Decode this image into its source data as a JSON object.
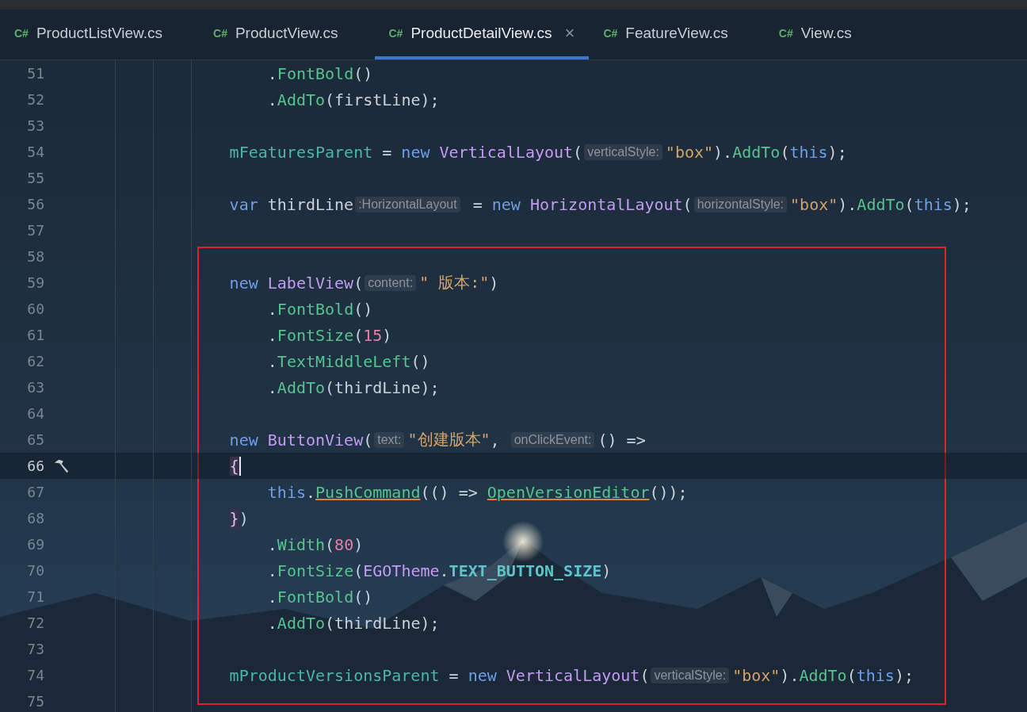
{
  "tabs": [
    {
      "icon": "C#",
      "label": "ProductListView.cs",
      "selected": false
    },
    {
      "icon": "C#",
      "label": "ProductView.cs",
      "selected": false
    },
    {
      "icon": "C#",
      "label": "ProductDetailView.cs",
      "selected": true,
      "close": "×"
    },
    {
      "icon": "C#",
      "label": "FeatureView.cs",
      "selected": false
    },
    {
      "icon": "C#",
      "label": "View.cs",
      "selected": false
    }
  ],
  "annotation": {
    "kind": "rectangle",
    "color": "#e0222c"
  },
  "lines": [
    {
      "number": "51",
      "current": false,
      "boxed": false,
      "kind": "continuation",
      "tokens": [
        {
          "kind": "plain",
          "text": "."
        },
        {
          "kind": "method",
          "text": "FontBold"
        },
        {
          "kind": "plain",
          "text": "()"
        }
      ]
    },
    {
      "number": "52",
      "current": false,
      "boxed": false,
      "kind": "continuation",
      "tokens": [
        {
          "kind": "plain",
          "text": "."
        },
        {
          "kind": "method",
          "text": "AddTo"
        },
        {
          "kind": "plain",
          "text": "(firstLine);"
        }
      ]
    },
    {
      "number": "53",
      "current": false,
      "boxed": false
    },
    {
      "number": "54",
      "current": false,
      "boxed": false,
      "kind": "statement",
      "tokens": [
        {
          "kind": "field",
          "text": "mFeaturesParent"
        },
        {
          "kind": "plain",
          "text": " = "
        },
        {
          "kind": "keyword",
          "text": "new "
        },
        {
          "kind": "type",
          "text": "VerticalLayout"
        },
        {
          "kind": "plain",
          "text": "("
        },
        {
          "kind": "hint",
          "text": "verticalStyle:"
        },
        {
          "kind": "string",
          "text": "\"box\""
        },
        {
          "kind": "plain",
          "text": ")."
        },
        {
          "kind": "method",
          "text": "AddTo"
        },
        {
          "kind": "plain",
          "text": "("
        },
        {
          "kind": "keyword",
          "text": "this"
        },
        {
          "kind": "plain",
          "text": ");"
        }
      ]
    },
    {
      "number": "55",
      "current": false,
      "boxed": false
    },
    {
      "number": "56",
      "current": false,
      "boxed": false,
      "kind": "statement",
      "tokens": [
        {
          "kind": "keyword",
          "text": "var"
        },
        {
          "kind": "plain",
          "text": " thirdLine"
        },
        {
          "kind": "hint",
          "text": ":HorizontalLayout"
        },
        {
          "kind": "plain",
          "text": " = "
        },
        {
          "kind": "keyword",
          "text": "new "
        },
        {
          "kind": "type",
          "text": "HorizontalLayout"
        },
        {
          "kind": "plain",
          "text": "("
        },
        {
          "kind": "hint",
          "text": "horizontalStyle:"
        },
        {
          "kind": "string",
          "text": "\"box\""
        },
        {
          "kind": "plain",
          "text": ")."
        },
        {
          "kind": "method",
          "text": "AddTo"
        },
        {
          "kind": "plain",
          "text": "("
        },
        {
          "kind": "keyword",
          "text": "this"
        },
        {
          "kind": "plain",
          "text": ");"
        }
      ]
    },
    {
      "number": "57",
      "current": false,
      "boxed": false
    },
    {
      "number": "58",
      "current": false,
      "boxed": true
    },
    {
      "number": "59",
      "current": false,
      "boxed": true,
      "kind": "statement",
      "tokens": [
        {
          "kind": "keyword",
          "text": "new "
        },
        {
          "kind": "type",
          "text": "LabelView"
        },
        {
          "kind": "plain",
          "text": "("
        },
        {
          "kind": "hint",
          "text": "content:"
        },
        {
          "kind": "string",
          "text": "\" 版本:\""
        },
        {
          "kind": "plain",
          "text": ")"
        }
      ]
    },
    {
      "number": "60",
      "current": false,
      "boxed": true,
      "kind": "continuation",
      "tokens": [
        {
          "kind": "plain",
          "text": "."
        },
        {
          "kind": "method",
          "text": "FontBold"
        },
        {
          "kind": "plain",
          "text": "()"
        }
      ]
    },
    {
      "number": "61",
      "current": false,
      "boxed": true,
      "kind": "continuation",
      "tokens": [
        {
          "kind": "plain",
          "text": "."
        },
        {
          "kind": "method",
          "text": "FontSize"
        },
        {
          "kind": "plain",
          "text": "("
        },
        {
          "kind": "number",
          "text": "15"
        },
        {
          "kind": "plain",
          "text": ")"
        }
      ]
    },
    {
      "number": "62",
      "current": false,
      "boxed": true,
      "kind": "continuation",
      "tokens": [
        {
          "kind": "plain",
          "text": "."
        },
        {
          "kind": "method",
          "text": "TextMiddleLeft"
        },
        {
          "kind": "plain",
          "text": "()"
        }
      ]
    },
    {
      "number": "63",
      "current": false,
      "boxed": true,
      "kind": "continuation",
      "tokens": [
        {
          "kind": "plain",
          "text": "."
        },
        {
          "kind": "method",
          "text": "AddTo"
        },
        {
          "kind": "plain",
          "text": "(thirdLine);"
        }
      ]
    },
    {
      "number": "64",
      "current": false,
      "boxed": true
    },
    {
      "number": "65",
      "current": false,
      "boxed": true,
      "kind": "statement",
      "tokens": [
        {
          "kind": "keyword",
          "text": "new "
        },
        {
          "kind": "type",
          "text": "ButtonView"
        },
        {
          "kind": "plain",
          "text": "("
        },
        {
          "kind": "hint",
          "text": "text:"
        },
        {
          "kind": "string",
          "text": "\"创建版本\""
        },
        {
          "kind": "plain",
          "text": ", "
        },
        {
          "kind": "hint",
          "text": "onClickEvent:"
        },
        {
          "kind": "plain",
          "text": "() =>"
        }
      ]
    },
    {
      "number": "66",
      "current": true,
      "boxed": true,
      "kind": "statement",
      "tokens": [
        {
          "kind": "brace",
          "text": "{"
        }
      ]
    },
    {
      "number": "67",
      "current": false,
      "boxed": true,
      "kind": "continuation",
      "tokens": [
        {
          "kind": "keyword",
          "text": "this"
        },
        {
          "kind": "plain",
          "text": "."
        },
        {
          "kind": "method_ref",
          "text": "PushCommand"
        },
        {
          "kind": "plain",
          "text": "(() => "
        },
        {
          "kind": "method_ref",
          "text": "OpenVersionEditor"
        },
        {
          "kind": "plain",
          "text": "());"
        }
      ]
    },
    {
      "number": "68",
      "current": false,
      "boxed": true,
      "kind": "statement",
      "tokens": [
        {
          "kind": "brace",
          "text": "}"
        },
        {
          "kind": "plain",
          "text": ")"
        }
      ]
    },
    {
      "number": "69",
      "current": false,
      "boxed": true,
      "kind": "continuation",
      "tokens": [
        {
          "kind": "plain",
          "text": "."
        },
        {
          "kind": "method",
          "text": "Width"
        },
        {
          "kind": "plain",
          "text": "("
        },
        {
          "kind": "number",
          "text": "80"
        },
        {
          "kind": "plain",
          "text": ")"
        }
      ]
    },
    {
      "number": "70",
      "current": false,
      "boxed": true,
      "kind": "continuation",
      "tokens": [
        {
          "kind": "plain",
          "text": "."
        },
        {
          "kind": "method",
          "text": "FontSize"
        },
        {
          "kind": "plain",
          "text": "("
        },
        {
          "kind": "type",
          "text": "EGOTheme"
        },
        {
          "kind": "plain",
          "text": "."
        },
        {
          "kind": "const",
          "text": "TEXT_BUTTON_SIZE"
        },
        {
          "kind": "plain",
          "text": ")"
        }
      ]
    },
    {
      "number": "71",
      "current": false,
      "boxed": true,
      "kind": "continuation",
      "tokens": [
        {
          "kind": "plain",
          "text": "."
        },
        {
          "kind": "method",
          "text": "FontBold"
        },
        {
          "kind": "plain",
          "text": "()"
        }
      ]
    },
    {
      "number": "72",
      "current": false,
      "boxed": true,
      "kind": "continuation",
      "tokens": [
        {
          "kind": "plain",
          "text": "."
        },
        {
          "kind": "method",
          "text": "AddTo"
        },
        {
          "kind": "plain",
          "text": "(thirdLine);"
        }
      ]
    },
    {
      "number": "73",
      "current": false,
      "boxed": true
    },
    {
      "number": "74",
      "current": false,
      "boxed": true,
      "kind": "statement",
      "tokens": [
        {
          "kind": "field",
          "text": "mProductVersionsParent"
        },
        {
          "kind": "plain",
          "text": " = "
        },
        {
          "kind": "keyword",
          "text": "new "
        },
        {
          "kind": "type",
          "text": "VerticalLayout"
        },
        {
          "kind": "plain",
          "text": "("
        },
        {
          "kind": "hint",
          "text": "verticalStyle:"
        },
        {
          "kind": "string",
          "text": "\"box\""
        },
        {
          "kind": "plain",
          "text": ")."
        },
        {
          "kind": "method",
          "text": "AddTo"
        },
        {
          "kind": "plain",
          "text": "("
        },
        {
          "kind": "keyword",
          "text": "this"
        },
        {
          "kind": "plain",
          "text": ");"
        }
      ]
    },
    {
      "number": "75",
      "current": false,
      "boxed": true
    }
  ]
}
